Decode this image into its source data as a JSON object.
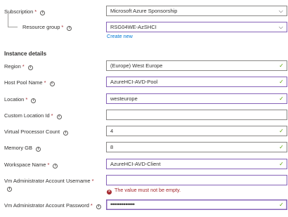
{
  "subscription": {
    "label": "Subscription",
    "required": "*",
    "value": "Microsoft Azure Sponsorship"
  },
  "resource_group": {
    "label": "Resource group",
    "required": "*",
    "value": "RSG04WE-AzSHCI",
    "create_new": "Create new"
  },
  "section_title": "Instance details",
  "region": {
    "label": "Region",
    "required": "*",
    "value": "(Europe) West Europe"
  },
  "host_pool": {
    "label": "Host Pool Name",
    "required": "*",
    "value": "AzureHCI-AVD-Pool"
  },
  "location": {
    "label": "Location",
    "required": "*",
    "value": "westeurope"
  },
  "custom_location": {
    "label": "Custom Location Id",
    "required": "*",
    "value": ""
  },
  "vcpu": {
    "label": "Virtual Processor Count",
    "value": "4"
  },
  "memory": {
    "label": "Memory GB",
    "value": "8"
  },
  "workspace": {
    "label": "Workspace Name",
    "required": "*",
    "value": "AzureHCI-AVD-Client"
  },
  "vm_admin_user": {
    "label": "Vm Administrator Account Username",
    "required": "*",
    "value": "",
    "error": "The value must not be empty."
  },
  "vm_admin_pw": {
    "label": "Vm Administrator Account Password",
    "required": "*",
    "value": "•••••••••••••"
  },
  "icons": {
    "info": "i",
    "check": "✓",
    "chevron": "⌵",
    "error": "✕"
  },
  "colors": {
    "accent": "#8764b8",
    "link": "#0078d4",
    "success": "#57a300",
    "error": "#a4262c"
  }
}
